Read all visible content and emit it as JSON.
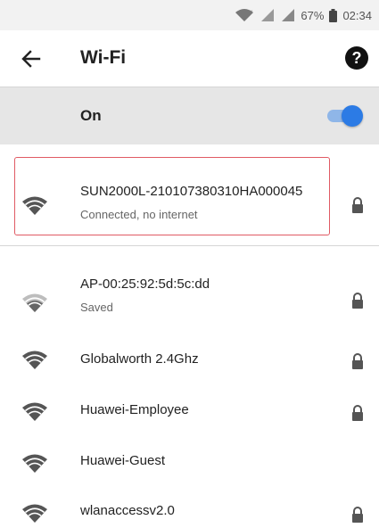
{
  "status_bar": {
    "battery_percent": "67%",
    "time": "02:34"
  },
  "app_bar": {
    "title": "Wi-Fi"
  },
  "wifi_toggle": {
    "label": "On",
    "enabled": true,
    "accent_color": "#2c7be5"
  },
  "connected_network": {
    "name": "SUN2000L-210107380310HA000045",
    "status": "Connected, no internet",
    "secured": true,
    "highlight_color": "#e05a64"
  },
  "networks": [
    {
      "name": "AP-00:25:92:5d:5c:dd",
      "status": "Saved",
      "secured": true,
      "signal": "weak"
    },
    {
      "name": "Globalworth 2.4Ghz",
      "status": "",
      "secured": true,
      "signal": "strong"
    },
    {
      "name": "Huawei-Employee",
      "status": "",
      "secured": true,
      "signal": "strong"
    },
    {
      "name": "Huawei-Guest",
      "status": "",
      "secured": false,
      "signal": "strong"
    },
    {
      "name": "wlanaccessv2.0",
      "status": "",
      "secured": true,
      "signal": "strong"
    }
  ]
}
